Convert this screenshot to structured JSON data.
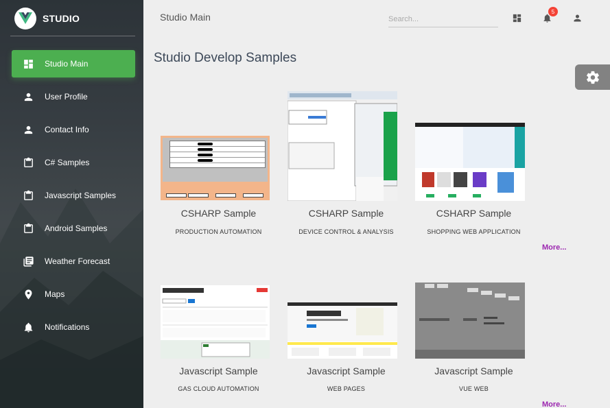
{
  "brand": {
    "name": "STUDIO"
  },
  "sidebar": {
    "items": [
      {
        "label": "Studio Main",
        "icon": "dashboard-icon",
        "active": true
      },
      {
        "label": "User Profile",
        "icon": "person-icon",
        "active": false
      },
      {
        "label": "Contact Info",
        "icon": "person-icon",
        "active": false
      },
      {
        "label": "C# Samples",
        "icon": "clipboard-icon",
        "active": false
      },
      {
        "label": "Javascript Samples",
        "icon": "clipboard-icon",
        "active": false
      },
      {
        "label": "Android Samples",
        "icon": "clipboard-icon",
        "active": false
      },
      {
        "label": "Weather Forecast",
        "icon": "library-books-icon",
        "active": false
      },
      {
        "label": "Maps",
        "icon": "location-pin-icon",
        "active": false
      },
      {
        "label": "Notifications",
        "icon": "bell-icon",
        "active": false
      }
    ]
  },
  "toolbar": {
    "title": "Studio Main",
    "search_placeholder": "Search...",
    "notification_count": "5"
  },
  "main": {
    "title": "Studio Develop Samples",
    "more_label": "More...",
    "cards": [
      {
        "title": "CSHARP Sample",
        "subtitle": "PRODUCTION AUTOMATION"
      },
      {
        "title": "CSHARP Sample",
        "subtitle": "DEVICE CONTROL & ANALYSIS"
      },
      {
        "title": "CSHARP Sample",
        "subtitle": "SHOPPING WEB APPLICATION"
      },
      {
        "title": "Javascript Sample",
        "subtitle": "GAS CLOUD AUTOMATION"
      },
      {
        "title": "Javascript Sample",
        "subtitle": "WEB PAGES"
      },
      {
        "title": "Javascript Sample",
        "subtitle": "VUE WEB"
      }
    ]
  },
  "colors": {
    "accent": "#4caf50",
    "more_link": "#9c27b0",
    "badge": "#f44336"
  }
}
